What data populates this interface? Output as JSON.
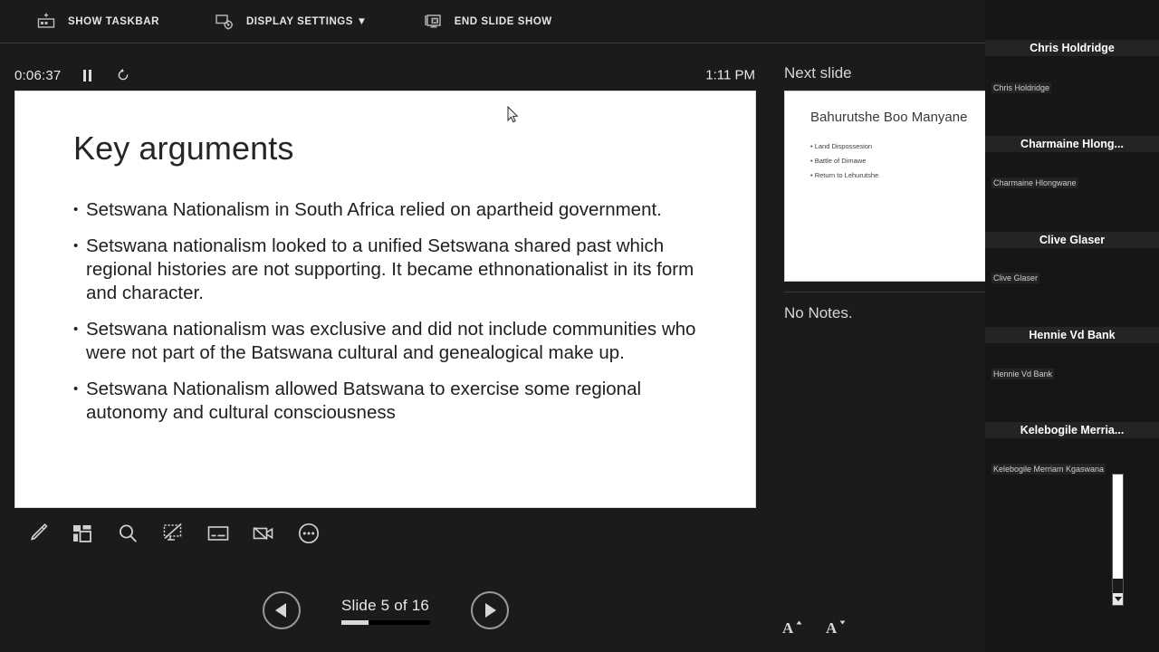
{
  "topbar": {
    "commands": [
      {
        "label": "SHOW TASKBAR",
        "icon": "taskbar-icon"
      },
      {
        "label": "DISPLAY SETTINGS ▼",
        "icon": "display-settings-icon"
      },
      {
        "label": "END SLIDE SHOW",
        "icon": "end-slideshow-icon"
      }
    ]
  },
  "timer": {
    "elapsed": "0:06:37",
    "pause_icon": "pause-icon",
    "reset_icon": "reset-icon",
    "clock": "1:11 PM"
  },
  "slide": {
    "title": "Key arguments",
    "bullet_glyph": "•",
    "bullets": [
      "Setswana Nationalism in South Africa relied on apartheid government.",
      "Setswana nationalism looked to a unified Setswana shared past which regional histories are not supporting. It became ethnonationalist in its form and character.",
      "Setswana nationalism was exclusive and did not include communities who were not part of the Batswana cultural and genealogical make up.",
      "Setswana Nationalism allowed Batswana to exercise some regional autonomy and cultural consciousness"
    ]
  },
  "tools": [
    {
      "name": "pen-icon",
      "title": "Pen"
    },
    {
      "name": "all-slides-icon",
      "title": "See all slides"
    },
    {
      "name": "zoom-icon",
      "title": "Zoom into the slide"
    },
    {
      "name": "black-screen-icon",
      "title": "Black or unblack slide show"
    },
    {
      "name": "subtitles-icon",
      "title": "Toggle subtitles"
    },
    {
      "name": "camera-off-icon",
      "title": "Turn camera off"
    },
    {
      "name": "more-options-icon",
      "title": "More slide show options"
    }
  ],
  "navigation": {
    "previous_icon": "previous-slide-icon",
    "next_icon": "next-slide-icon",
    "counter": "Slide 5 of 16",
    "progress_percent": 31
  },
  "next_slide": {
    "heading": "Next slide",
    "title": "Bahurutshe Boo Manyane",
    "bullet_glyph": "•",
    "bullets": [
      "Land Dispossesion",
      "Battle of Dimawe",
      "Return to Lehurutshe"
    ]
  },
  "notes": {
    "text": "No Notes.",
    "increase_font_icon": "increase-font-size-icon",
    "decrease_font_icon": "decrease-font-size-icon"
  },
  "participants": [
    {
      "display_name": "Chris Holdridge",
      "label": "Chris Holdridge"
    },
    {
      "display_name": "Charmaine  Hlong...",
      "label": "Charmaine Hlongwane"
    },
    {
      "display_name": "Clive Glaser",
      "label": "Clive Glaser"
    },
    {
      "display_name": "Hennie Vd Bank",
      "label": "Hennie Vd Bank"
    },
    {
      "display_name": "Kelebogile  Merria...",
      "label": "Kelebogile Merriam Kgaswana"
    }
  ],
  "scrollbar": {
    "down_icon": "scroll-down-icon"
  },
  "colors": {
    "app_background": "#1b1b1b",
    "rail_background": "#161616",
    "slide_background": "#ffffff",
    "text_primary": "#e6e6e6",
    "slide_text": "#1f1f1f"
  }
}
